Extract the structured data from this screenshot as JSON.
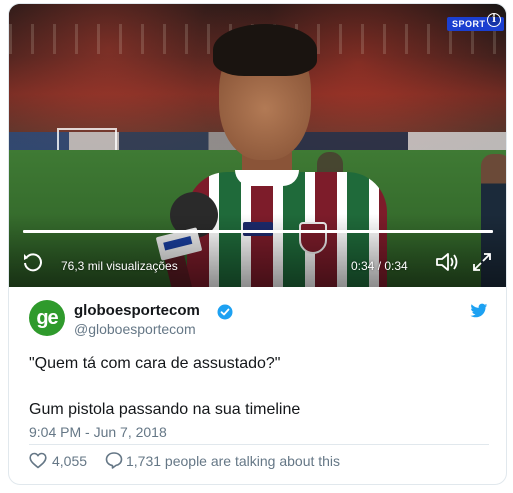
{
  "video": {
    "channel_badge": "SPORT",
    "views": "76,3 mil visualizações",
    "time": "0:34 / 0:34",
    "progress": 1.0
  },
  "tweet": {
    "avatar_text": "ge",
    "author_name": "globoesportecom",
    "handle": "@globoesportecom",
    "line1": "\"Quem tá com cara de assustado?\"",
    "line2": "Gum pistola passando na sua timeline",
    "timestamp": "9:04 PM - Jun 7, 2018",
    "likes": "4,055",
    "talking": "1,731 people are talking about this"
  },
  "colors": {
    "verified": "#1da1f2",
    "twitter_bird": "#1da1f2",
    "secondary_text": "#657786",
    "avatar_bg": "#2f9a2c"
  },
  "icons": [
    "replay-icon",
    "volume-icon",
    "fullscreen-icon",
    "info-icon",
    "verified-icon",
    "twitter-bird-icon",
    "heart-icon",
    "reply-icon"
  ]
}
